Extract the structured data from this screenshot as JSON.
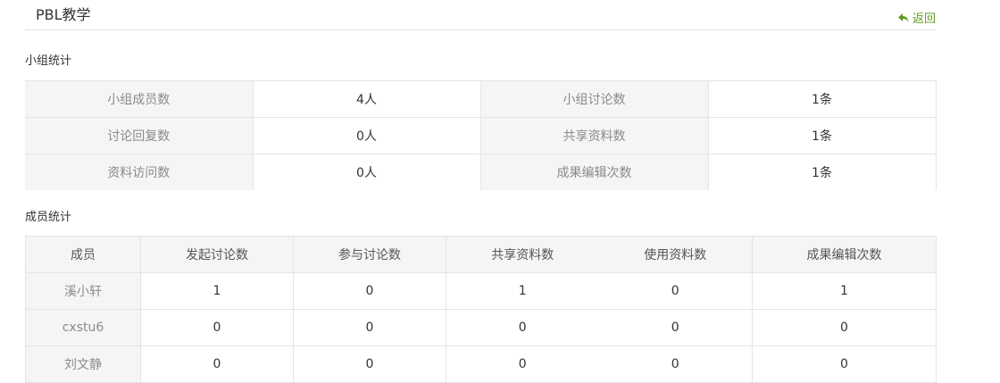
{
  "header": {
    "title": "PBL教学",
    "back_label": "返回"
  },
  "group_stats": {
    "title": "小组统计",
    "rows": [
      {
        "label1": "小组成员数",
        "value1": "4人",
        "label2": "小组讨论数",
        "value2": "1条"
      },
      {
        "label1": "讨论回复数",
        "value1": "0人",
        "label2": "共享资料数",
        "value2": "1条"
      },
      {
        "label1": "资料访问数",
        "value1": "0人",
        "label2": "成果编辑次数",
        "value2": "1条"
      }
    ]
  },
  "member_stats": {
    "title": "成员统计",
    "columns": [
      "成员",
      "发起讨论数",
      "参与讨论数",
      "共享资料数",
      "使用资料数",
      "成果编辑次数"
    ],
    "rows": [
      [
        "溪小轩",
        "1",
        "0",
        "1",
        "0",
        "1"
      ],
      [
        "cxstu6",
        "0",
        "0",
        "0",
        "0",
        "0"
      ],
      [
        "刘文静",
        "0",
        "0",
        "0",
        "0",
        "0"
      ]
    ]
  },
  "colors": {
    "accent": "#5f9a1f",
    "label_bg": "#f5f5f5",
    "border": "#e4e4e4"
  }
}
